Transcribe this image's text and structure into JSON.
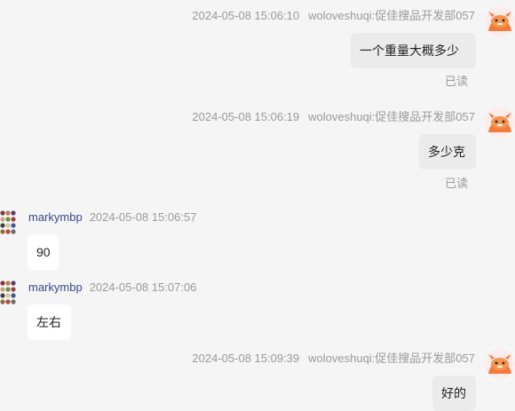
{
  "messages": [
    {
      "side": "right",
      "time": "2024-05-08 15:06:10",
      "sender": "woloveshuqi:促佳搜品开发部057",
      "text": "一个重量大概多少",
      "read": "已读"
    },
    {
      "side": "right",
      "time": "2024-05-08 15:06:19",
      "sender": "woloveshuqi:促佳搜品开发部057",
      "text": "多少克",
      "read": "已读"
    },
    {
      "side": "left",
      "time": "2024-05-08 15:06:57",
      "sender": "markymbp",
      "text": "90"
    },
    {
      "side": "left",
      "time": "2024-05-08 15:07:06",
      "sender": "markymbp",
      "text": "左右"
    },
    {
      "side": "right",
      "time": "2024-05-08 15:09:39",
      "sender": "woloveshuqi:促佳搜品开发部057",
      "text": "好的"
    }
  ],
  "colors": {
    "background": "#f5f5f5",
    "self_bubble": "#ebebeb",
    "other_bubble": "#ffffff",
    "meta_text": "#9a9a9a",
    "sender_name_left": "#3b4a8c",
    "avatar_orange": "#f47a3a"
  },
  "icons": {
    "self_avatar": "orange-cartoon-monster-avatar",
    "other_avatar": "colorful-dots-grid-avatar"
  }
}
